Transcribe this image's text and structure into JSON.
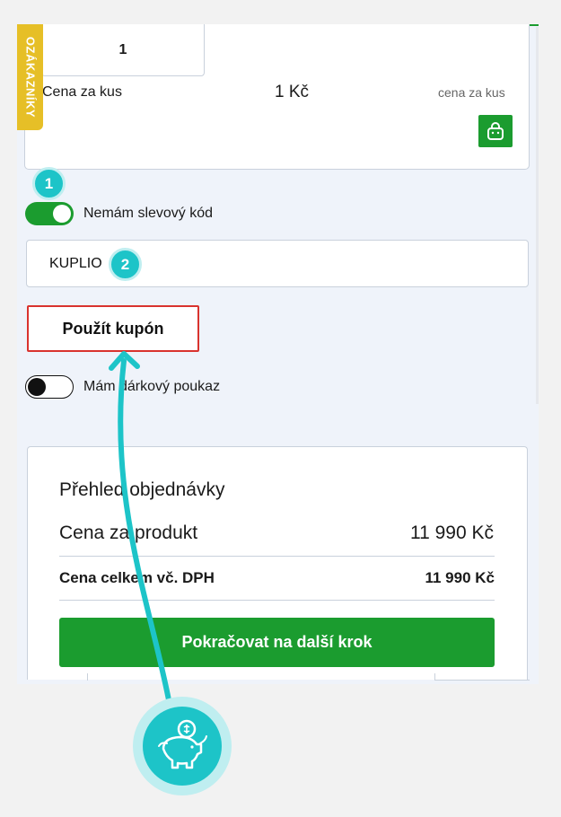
{
  "product": {
    "quantity": "1",
    "unit_price_label": "Cena za kus",
    "unit_price_value": "1 Kč",
    "unit_price_hint": "cena za kus"
  },
  "side_tab": {
    "label": "OZÁKAZNÍKY"
  },
  "steps": {
    "step1": "1",
    "step2": "2"
  },
  "discount": {
    "toggle_label": "Nemám slevový kód",
    "toggle_on": true,
    "coupon_value": "KUPLIO",
    "apply_label": "Použít kupón"
  },
  "gift": {
    "toggle_label": "Mám dárkový poukaz",
    "toggle_on": false
  },
  "summary": {
    "title": "Přehled objednávky",
    "product_price_label": "Cena za produkt",
    "product_price_value": "11 990 Kč",
    "total_label": "Cena celkem vč. DPH",
    "total_value": "11 990 Kč",
    "continue_label": "Pokračovat na další krok"
  },
  "colors": {
    "accent_green": "#1b9c2f",
    "highlight_teal": "#1dc4c8",
    "apply_border_red": "#d9332e",
    "side_tab_yellow": "#e6bf27"
  },
  "icons": [
    "shopping-bag-icon",
    "piggy-bank-icon",
    "arrow-icon"
  ]
}
